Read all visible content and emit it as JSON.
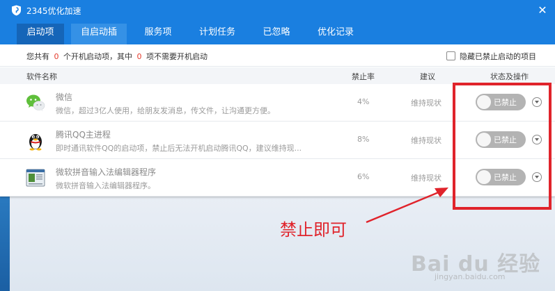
{
  "app": {
    "title": "2345优化加速",
    "close_glyph": "✕"
  },
  "tabs": [
    {
      "label": "启动项",
      "active": true
    },
    {
      "label": "自启动插件",
      "active": false
    },
    {
      "label": "服务项",
      "active": false
    },
    {
      "label": "计划任务",
      "active": false
    },
    {
      "label": "已忽略",
      "active": false
    },
    {
      "label": "优化记录",
      "active": false
    }
  ],
  "summary": {
    "prefix": "您共有",
    "total": "0",
    "middle": "个开机启动项，其中",
    "unneeded": "0",
    "suffix": "项不需要开机启动",
    "hide_disabled_label": "隐藏已禁止启动的项目",
    "hide_disabled_checked": false
  },
  "table": {
    "headers": {
      "name": "软件名称",
      "rate": "禁止率",
      "advice": "建议",
      "status": "状态及操作"
    },
    "rows": [
      {
        "icon": "wechat-icon",
        "name": "微信",
        "desc": "微信，超过3亿人使用，给朋友发消息，传文件，让沟通更方便。",
        "rate": "4%",
        "advice": "维持现状",
        "status_label": "已禁止"
      },
      {
        "icon": "qq-penguin-icon",
        "name": "腾讯QQ主进程",
        "desc": "即时通讯软件QQ的启动项，禁止后无法开机启动腾讯QQ，建议维持现...",
        "rate": "8%",
        "advice": "维持现状",
        "status_label": "已禁止"
      },
      {
        "icon": "pinyin-ime-icon",
        "name": "微软拼音输入法编辑器程序",
        "desc": "微软拼音输入法编辑器程序。",
        "rate": "6%",
        "advice": "维持现状",
        "status_label": "已禁止"
      }
    ]
  },
  "annotation": {
    "text": "禁止即可",
    "color": "#e0232b"
  },
  "watermark": {
    "main": "Bai du 经验",
    "sub": "jingyan.baidu.com"
  },
  "colors": {
    "brand_blue": "#1a7fe0",
    "highlight_red": "#e0232b",
    "count_red": "#e43b2c"
  }
}
